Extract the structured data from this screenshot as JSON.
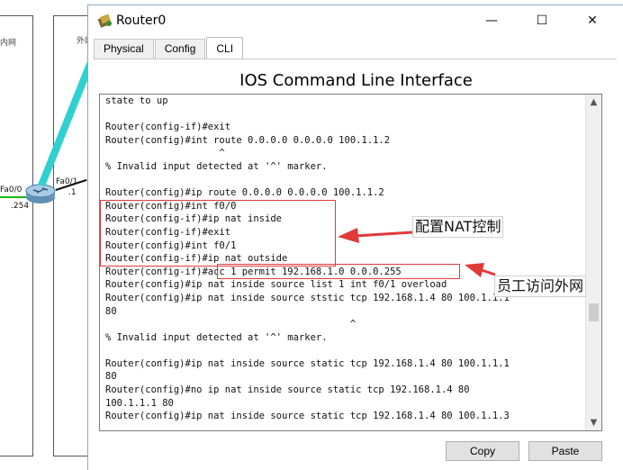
{
  "background": {
    "left_area_label": "内网",
    "right_area_label": "外网",
    "ports": {
      "left_port": "Fa0/0",
      "left_ip": ".254",
      "right_port": "Fa0/1",
      "right_ip": ".1"
    }
  },
  "window": {
    "title": "Router0",
    "icon": "router-icon",
    "controls": {
      "minimize": "—",
      "maximize": "☐",
      "close": "✕"
    }
  },
  "tabs": [
    {
      "label": "Physical",
      "active": false
    },
    {
      "label": "Config",
      "active": false
    },
    {
      "label": "CLI",
      "active": true
    }
  ],
  "cli": {
    "heading": "IOS Command Line Interface",
    "lines": [
      "state to up",
      "",
      "Router(config-if)#exit",
      "Router(config)#int route 0.0.0.0 0.0.0.0 100.1.1.2",
      "                    ^",
      "% Invalid input detected at '^' marker.",
      "",
      "Router(config)#ip route 0.0.0.0 0.0.0.0 100.1.1.2",
      "Router(config)#int f0/0",
      "Router(config-if)#ip nat inside",
      "Router(config-if)#exit",
      "Router(config)#int f0/1",
      "Router(config-if)#ip nat outside",
      "Router(config-if)#acc 1 permit 192.168.1.0 0.0.0.255",
      "Router(config)#ip nat inside source list 1 int f0/1 overload",
      "Router(config)#ip nat inside source ststic tcp 192.168.1.4 80 100.1.1.1",
      "80",
      "                                           ^",
      "% Invalid input detected at '^' marker.",
      "",
      "Router(config)#ip nat inside source static tcp 192.168.1.4 80 100.1.1.1",
      "80",
      "Router(config)#no ip nat inside source static tcp 192.168.1.4 80",
      "100.1.1.1 80",
      "Router(config)#ip nat inside source static tcp 192.168.1.4 80 100.1.1.3"
    ],
    "scroll_up": "▲",
    "scroll_down": "▼"
  },
  "buttons": {
    "copy": "Copy",
    "paste": "Paste"
  },
  "annotations": {
    "nat_control": "配置NAT控制",
    "staff_internet": "员工访问外网",
    "color": "#e03a3a"
  }
}
